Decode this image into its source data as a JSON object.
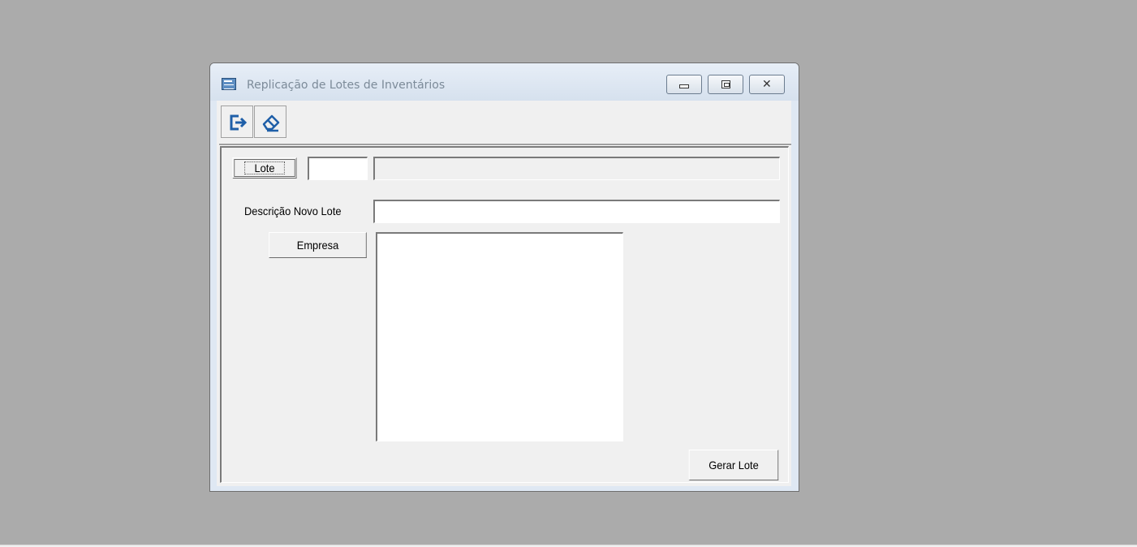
{
  "window": {
    "title": "Replicação de Lotes de Inventários",
    "controls": {
      "minimize": "minimize",
      "maximize": "maximize",
      "close": "close"
    }
  },
  "toolbar": {
    "buttons": [
      {
        "name": "exit",
        "icon": "exit-icon"
      },
      {
        "name": "clear",
        "icon": "eraser-icon"
      }
    ]
  },
  "form": {
    "lote_button": "Lote",
    "lote_code_value": "",
    "lote_description_value": "",
    "descricao_label": "Descrição Novo Lote",
    "descricao_value": "",
    "empresa_button": "Empresa",
    "empresa_items": [],
    "gerar_button": "Gerar Lote"
  },
  "colors": {
    "desktop": "#ababab",
    "titlebar": "#dfe8f3",
    "window_face": "#f0f0f0",
    "icon_blue": "#1f5fa8"
  }
}
